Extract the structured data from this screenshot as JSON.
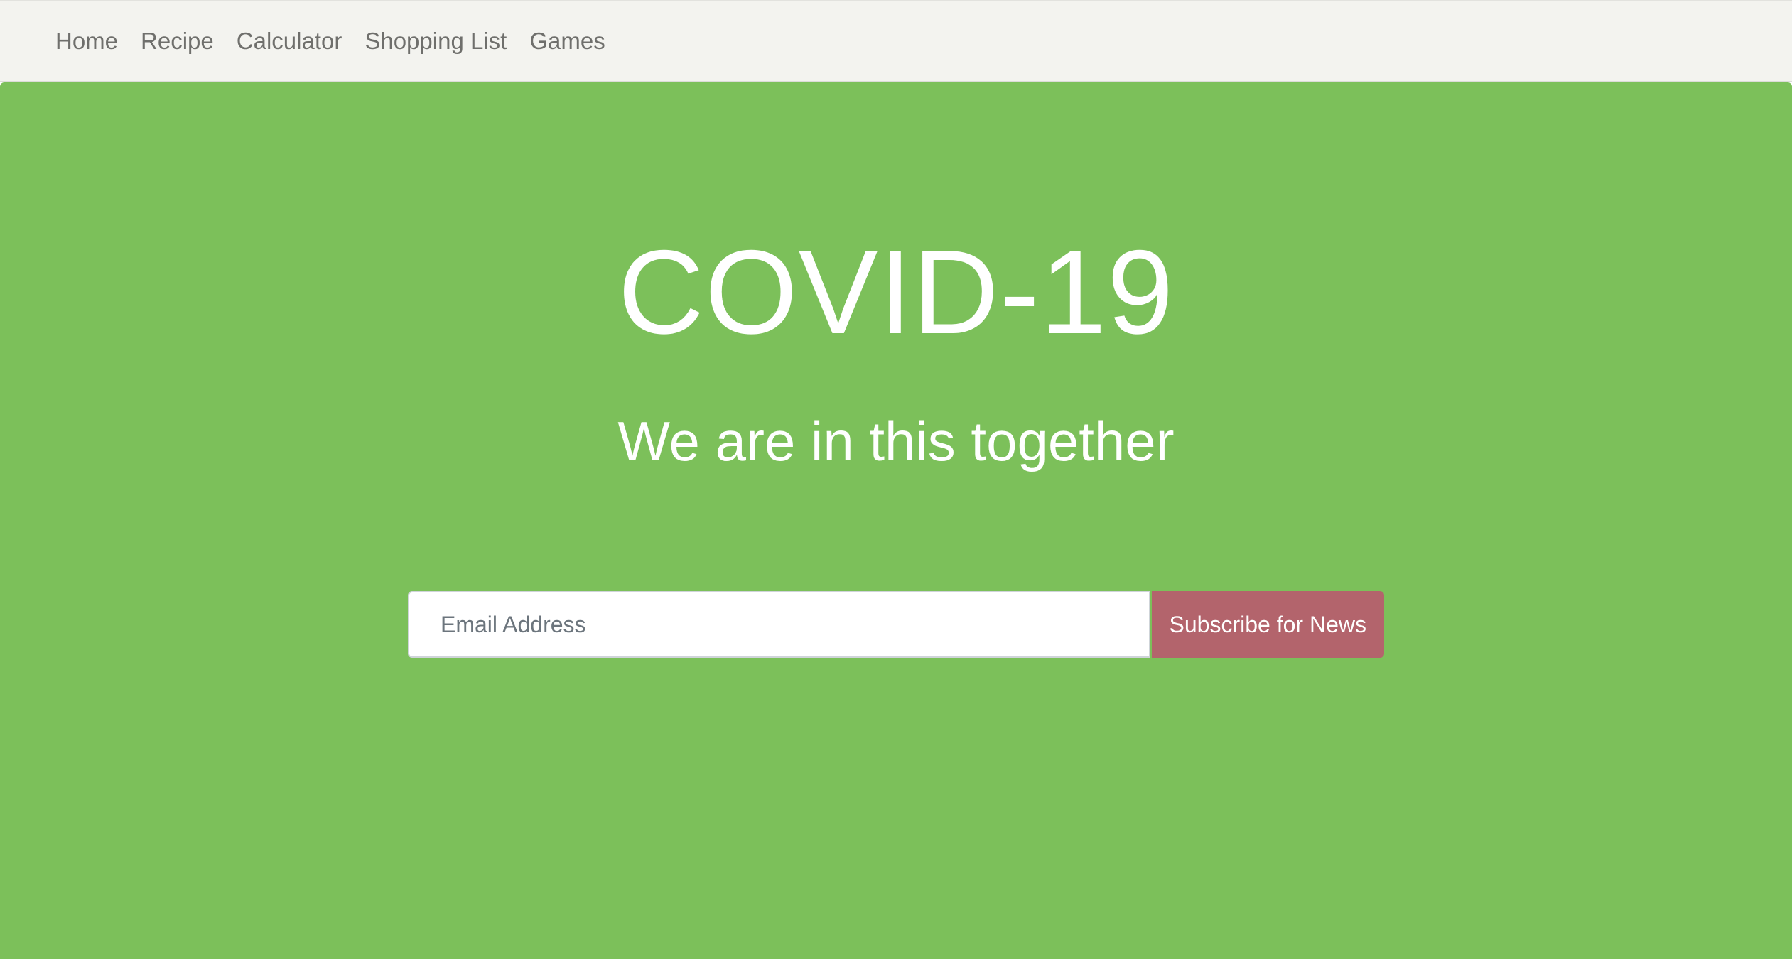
{
  "nav": {
    "items": [
      {
        "label": "Home"
      },
      {
        "label": "Recipe"
      },
      {
        "label": "Calculator"
      },
      {
        "label": "Shopping List"
      },
      {
        "label": "Games"
      }
    ]
  },
  "hero": {
    "title": "COVID-19",
    "subtitle": "We are in this together",
    "background_color": "#7cc05a"
  },
  "subscribe": {
    "email_placeholder": "Email Address",
    "email_value": "",
    "button_label": "Subscribe for News",
    "button_color": "#b3646c"
  }
}
